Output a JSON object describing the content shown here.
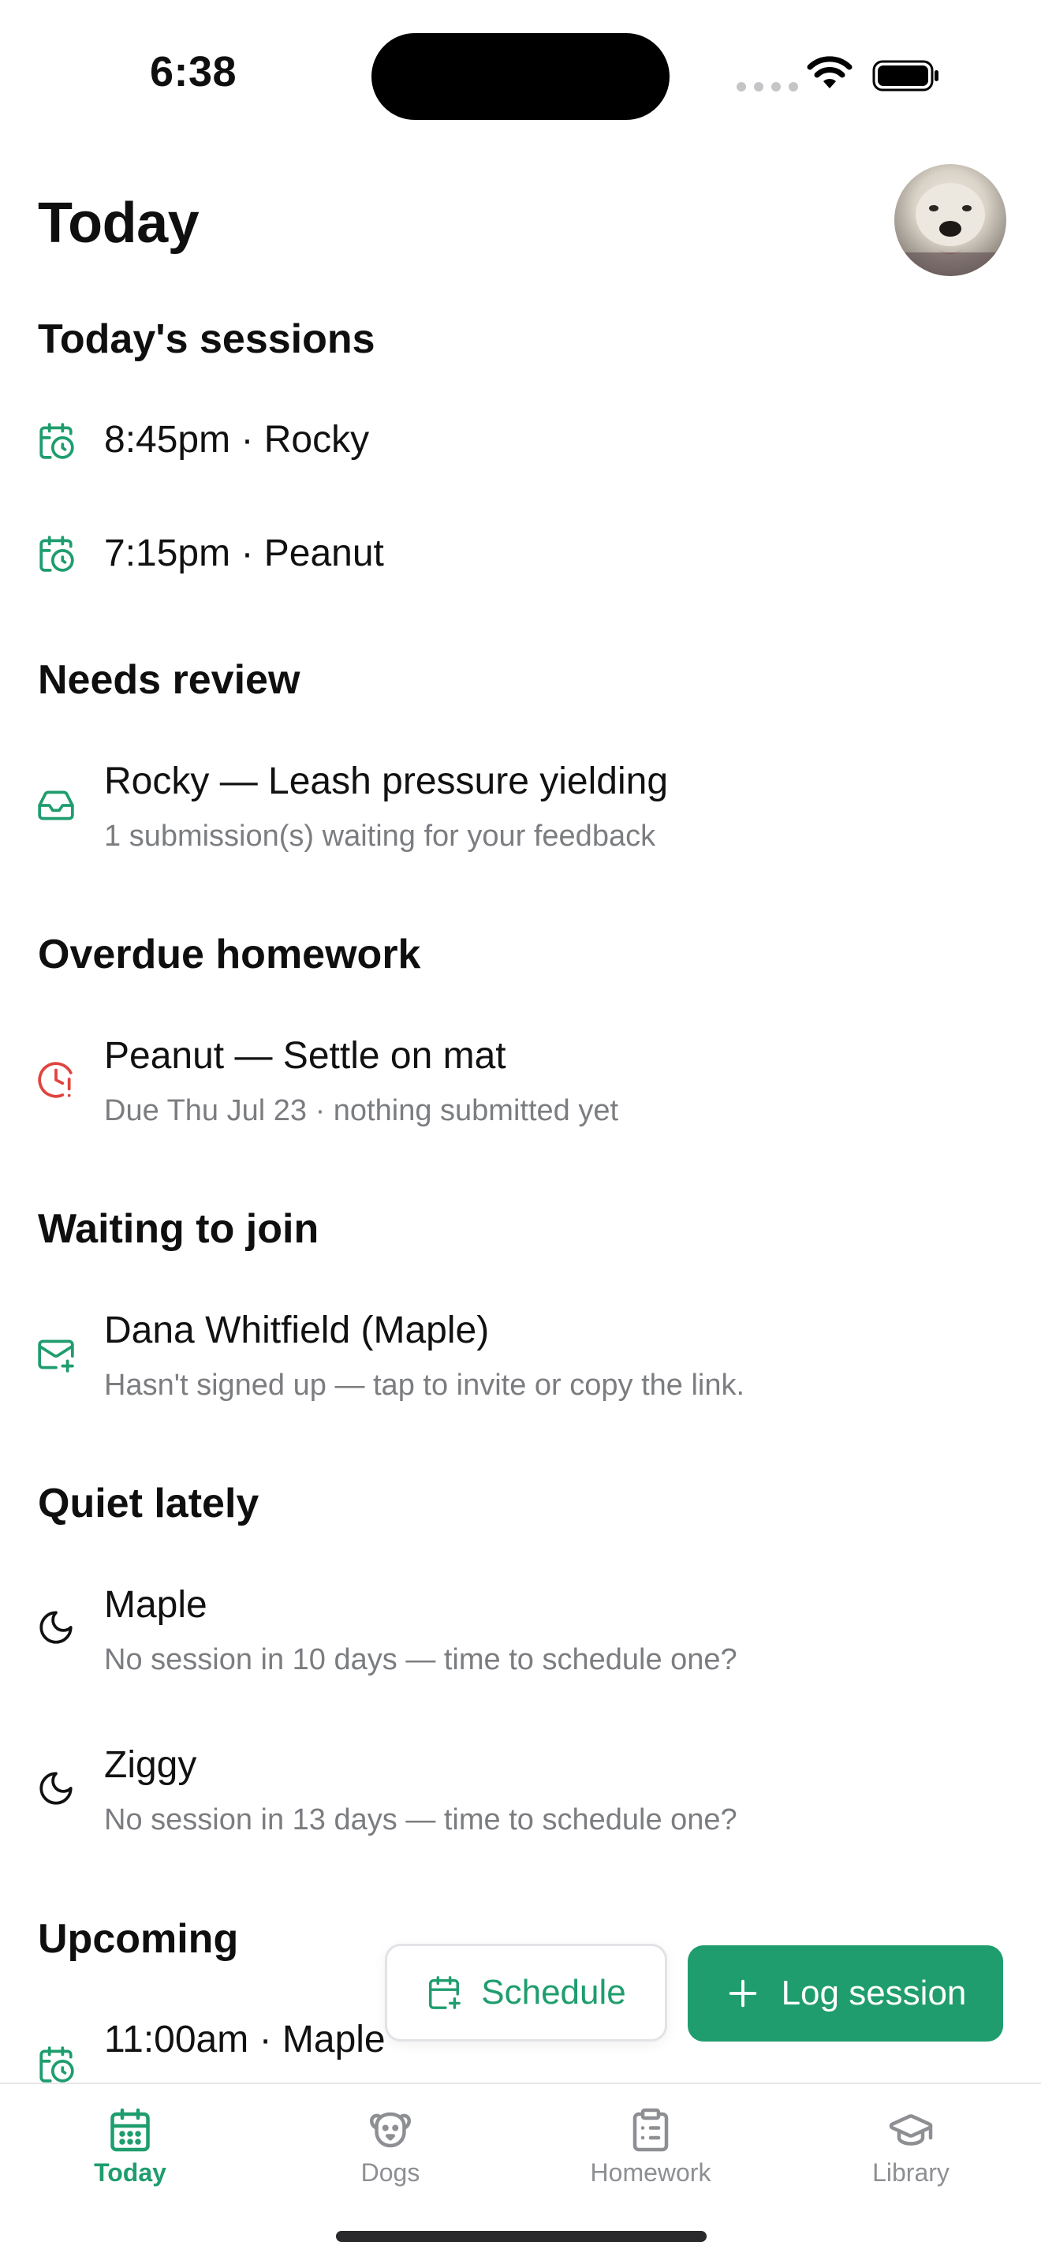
{
  "status_bar": {
    "time": "6:38"
  },
  "header": {
    "title": "Today"
  },
  "sections": {
    "todays_sessions": {
      "title": "Today's sessions",
      "items": [
        {
          "title": "8:45pm · Rocky",
          "icon": "calendar-clock-icon"
        },
        {
          "title": "7:15pm · Peanut",
          "icon": "calendar-clock-icon"
        }
      ]
    },
    "needs_review": {
      "title": "Needs review",
      "items": [
        {
          "title": "Rocky — Leash pressure yielding",
          "subtitle": "1 submission(s) waiting for your feedback",
          "icon": "inbox-icon"
        }
      ]
    },
    "overdue_homework": {
      "title": "Overdue homework",
      "items": [
        {
          "title": "Peanut — Settle on mat",
          "subtitle": "Due Thu Jul 23 · nothing submitted yet",
          "icon": "clock-alert-icon"
        }
      ]
    },
    "waiting_to_join": {
      "title": "Waiting to join",
      "items": [
        {
          "title": "Dana Whitfield (Maple)",
          "subtitle": "Hasn't signed up — tap to invite or copy the link.",
          "icon": "mail-plus-icon"
        }
      ]
    },
    "quiet_lately": {
      "title": "Quiet lately",
      "items": [
        {
          "title": "Maple",
          "subtitle": "No session in 10 days — time to schedule one?",
          "icon": "moon-icon"
        },
        {
          "title": "Ziggy",
          "subtitle": "No session in 13 days — time to schedule one?",
          "icon": "moon-icon"
        }
      ]
    },
    "upcoming": {
      "title": "Upcoming",
      "items": [
        {
          "title": "11:00am · Maple",
          "icon": "calendar-clock-icon"
        }
      ]
    }
  },
  "actions": {
    "schedule_label": "Schedule",
    "log_session_label": "Log session"
  },
  "tabs": [
    {
      "label": "Today",
      "icon": "calendar-icon",
      "active": true
    },
    {
      "label": "Dogs",
      "icon": "dog-icon",
      "active": false
    },
    {
      "label": "Homework",
      "icon": "clipboard-list-icon",
      "active": false
    },
    {
      "label": "Library",
      "icon": "graduation-cap-icon",
      "active": false
    }
  ],
  "colors": {
    "accent": "#1f9d6e",
    "alert": "#e0443e",
    "muted_text": "#7b7d80"
  }
}
